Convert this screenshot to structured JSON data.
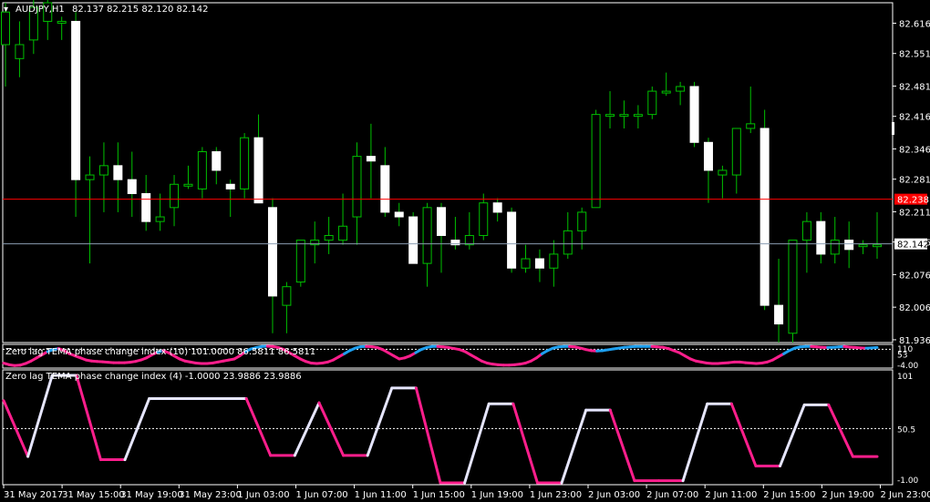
{
  "main_header": {
    "symbol": "AUDJPY,H1",
    "ohlc": "82.137 82.215 82.120 82.142"
  },
  "price_axis": {
    "ticks": [
      "82.616",
      "82.551",
      "82.481",
      "82.416",
      "82.346",
      "82.281",
      "82.211",
      "82.146",
      "82.076",
      "82.006",
      "81.936"
    ],
    "red_line_price": "82.238",
    "bid_price": "82.142"
  },
  "indicator1": {
    "title": "Zero lag TEMA phase change index (10) 101.0000 86.5811 86.5811",
    "axis_labels": [
      "110",
      "53",
      "-4.00"
    ]
  },
  "indicator2": {
    "title": "Zero lag TEMA phase change index (4) -1.0000 23.9886 23.9886",
    "axis_labels": [
      "101",
      "50.5",
      "-1.00"
    ]
  },
  "time_axis": {
    "labels": [
      "31 May 2017",
      "31 May 15:00",
      "31 May 19:00",
      "31 May 23:00",
      "1 Jun 03:00",
      "1 Jun 07:00",
      "1 Jun 11:00",
      "1 Jun 15:00",
      "1 Jun 19:00",
      "1 Jun 23:00",
      "2 Jun 03:00",
      "2 Jun 07:00",
      "2 Jun 11:00",
      "2 Jun 15:00",
      "2 Jun 19:00",
      "2 Jun 23:00"
    ]
  },
  "colors": {
    "background": "#000000",
    "grid": "#ffffff",
    "bull_candle": "#ffffff",
    "wick": "#00c000",
    "red_line": "#ff0000",
    "bid_line": "#8a9bb0",
    "ind_pink": "#ff1e8c",
    "ind_cyan": "#1ea0f0",
    "ind_white": "#e6e6ff"
  },
  "chart_data": [
    {
      "type": "candlestick",
      "title": "AUDJPY,H1",
      "ylim": [
        81.93,
        82.66
      ],
      "candles": [
        {
          "o": 82.57,
          "h": 82.66,
          "l": 82.48,
          "c": 82.64
        },
        {
          "o": 82.54,
          "h": 82.62,
          "l": 82.5,
          "c": 82.57
        },
        {
          "o": 82.58,
          "h": 82.67,
          "l": 82.55,
          "c": 82.65
        },
        {
          "o": 82.62,
          "h": 82.68,
          "l": 82.58,
          "c": 82.66
        },
        {
          "o": 82.62,
          "h": 82.63,
          "l": 82.58,
          "c": 82.62
        },
        {
          "o": 82.62,
          "h": 82.64,
          "l": 82.2,
          "c": 82.28
        },
        {
          "o": 82.28,
          "h": 82.33,
          "l": 82.1,
          "c": 82.29
        },
        {
          "o": 82.29,
          "h": 82.36,
          "l": 82.21,
          "c": 82.31
        },
        {
          "o": 82.31,
          "h": 82.36,
          "l": 82.21,
          "c": 82.28
        },
        {
          "o": 82.28,
          "h": 82.34,
          "l": 82.2,
          "c": 82.25
        },
        {
          "o": 82.25,
          "h": 82.29,
          "l": 82.17,
          "c": 82.19
        },
        {
          "o": 82.19,
          "h": 82.25,
          "l": 82.17,
          "c": 82.2
        },
        {
          "o": 82.22,
          "h": 82.29,
          "l": 82.18,
          "c": 82.27
        },
        {
          "o": 82.27,
          "h": 82.31,
          "l": 82.26,
          "c": 82.27
        },
        {
          "o": 82.26,
          "h": 82.35,
          "l": 82.24,
          "c": 82.34
        },
        {
          "o": 82.34,
          "h": 82.35,
          "l": 82.27,
          "c": 82.3
        },
        {
          "o": 82.27,
          "h": 82.28,
          "l": 82.2,
          "c": 82.26
        },
        {
          "o": 82.26,
          "h": 82.38,
          "l": 82.24,
          "c": 82.37
        },
        {
          "o": 82.37,
          "h": 82.42,
          "l": 82.23,
          "c": 82.23
        },
        {
          "o": 82.22,
          "h": 82.24,
          "l": 81.95,
          "c": 82.03
        },
        {
          "o": 82.01,
          "h": 82.06,
          "l": 81.95,
          "c": 82.05
        },
        {
          "o": 82.06,
          "h": 82.15,
          "l": 82.05,
          "c": 82.15
        },
        {
          "o": 82.14,
          "h": 82.19,
          "l": 82.1,
          "c": 82.15
        },
        {
          "o": 82.15,
          "h": 82.2,
          "l": 82.12,
          "c": 82.16
        },
        {
          "o": 82.15,
          "h": 82.25,
          "l": 82.14,
          "c": 82.18
        },
        {
          "o": 82.2,
          "h": 82.36,
          "l": 82.14,
          "c": 82.33
        },
        {
          "o": 82.33,
          "h": 82.4,
          "l": 82.24,
          "c": 82.32
        },
        {
          "o": 82.31,
          "h": 82.35,
          "l": 82.2,
          "c": 82.21
        },
        {
          "o": 82.21,
          "h": 82.23,
          "l": 82.18,
          "c": 82.2
        },
        {
          "o": 82.2,
          "h": 82.21,
          "l": 82.1,
          "c": 82.1
        },
        {
          "o": 82.1,
          "h": 82.23,
          "l": 82.05,
          "c": 82.22
        },
        {
          "o": 82.22,
          "h": 82.23,
          "l": 82.08,
          "c": 82.16
        },
        {
          "o": 82.15,
          "h": 82.2,
          "l": 82.13,
          "c": 82.14
        },
        {
          "o": 82.14,
          "h": 82.21,
          "l": 82.13,
          "c": 82.16
        },
        {
          "o": 82.16,
          "h": 82.25,
          "l": 82.15,
          "c": 82.23
        },
        {
          "o": 82.23,
          "h": 82.24,
          "l": 82.19,
          "c": 82.21
        },
        {
          "o": 82.21,
          "h": 82.22,
          "l": 82.08,
          "c": 82.09
        },
        {
          "o": 82.09,
          "h": 82.14,
          "l": 82.08,
          "c": 82.11
        },
        {
          "o": 82.11,
          "h": 82.13,
          "l": 82.06,
          "c": 82.09
        },
        {
          "o": 82.09,
          "h": 82.15,
          "l": 82.05,
          "c": 82.12
        },
        {
          "o": 82.12,
          "h": 82.21,
          "l": 82.11,
          "c": 82.17
        },
        {
          "o": 82.17,
          "h": 82.22,
          "l": 82.13,
          "c": 82.21
        },
        {
          "o": 82.22,
          "h": 82.43,
          "l": 82.22,
          "c": 82.42
        },
        {
          "o": 82.42,
          "h": 82.47,
          "l": 82.39,
          "c": 82.42
        },
        {
          "o": 82.42,
          "h": 82.45,
          "l": 82.39,
          "c": 82.42
        },
        {
          "o": 82.42,
          "h": 82.44,
          "l": 82.39,
          "c": 82.42
        },
        {
          "o": 82.42,
          "h": 82.48,
          "l": 82.41,
          "c": 82.47
        },
        {
          "o": 82.47,
          "h": 82.51,
          "l": 82.46,
          "c": 82.47
        },
        {
          "o": 82.47,
          "h": 82.49,
          "l": 82.44,
          "c": 82.48
        },
        {
          "o": 82.48,
          "h": 82.49,
          "l": 82.35,
          "c": 82.36
        },
        {
          "o": 82.36,
          "h": 82.37,
          "l": 82.23,
          "c": 82.3
        },
        {
          "o": 82.29,
          "h": 82.31,
          "l": 82.24,
          "c": 82.3
        },
        {
          "o": 82.29,
          "h": 82.39,
          "l": 82.25,
          "c": 82.39
        },
        {
          "o": 82.39,
          "h": 82.48,
          "l": 82.38,
          "c": 82.4
        },
        {
          "o": 82.39,
          "h": 82.43,
          "l": 82.0,
          "c": 82.01
        },
        {
          "o": 82.01,
          "h": 82.11,
          "l": 81.93,
          "c": 81.97
        },
        {
          "o": 81.95,
          "h": 82.12,
          "l": 81.93,
          "c": 82.15
        },
        {
          "o": 82.15,
          "h": 82.21,
          "l": 82.08,
          "c": 82.19
        },
        {
          "o": 82.19,
          "h": 82.21,
          "l": 82.1,
          "c": 82.12
        },
        {
          "o": 82.12,
          "h": 82.2,
          "l": 82.1,
          "c": 82.15
        },
        {
          "o": 82.15,
          "h": 82.19,
          "l": 82.09,
          "c": 82.13
        },
        {
          "o": 82.14,
          "h": 82.15,
          "l": 82.12,
          "c": 82.14
        },
        {
          "o": 82.14,
          "h": 82.21,
          "l": 82.11,
          "c": 82.14
        }
      ]
    },
    {
      "type": "line",
      "title": "Zero lag TEMA phase change index (10)",
      "ylim": [
        -4,
        110
      ],
      "values": [
        20,
        12,
        8,
        10,
        18,
        30,
        45,
        60,
        75,
        85,
        90,
        80,
        65,
        55,
        45,
        35,
        30,
        28,
        26,
        24,
        22,
        22,
        22,
        24,
        28,
        35,
        45,
        60,
        72,
        80,
        70,
        55,
        40,
        30,
        25,
        20,
        18,
        18,
        20,
        25,
        30,
        35,
        40,
        55,
        75,
        88,
        95,
        100,
        101,
        100,
        95,
        85,
        70,
        55,
        40,
        28,
        20,
        18,
        20,
        25,
        35,
        50,
        65,
        80,
        92,
        99,
        100,
        99,
        95,
        85,
        70,
        55,
        40,
        45,
        55,
        70,
        85,
        95,
        100,
        100,
        98,
        95,
        90,
        85,
        75,
        60,
        45,
        30,
        20,
        15,
        12,
        10,
        10,
        12,
        15,
        20,
        30,
        45,
        65,
        80,
        92,
        98,
        100,
        100,
        98,
        92,
        85,
        80,
        78,
        80,
        84,
        88,
        92,
        96,
        98,
        100,
        100,
        100,
        100,
        98,
        96,
        90,
        80,
        70,
        55,
        40,
        30,
        25,
        20,
        18,
        18,
        20,
        22,
        25,
        25,
        22,
        20,
        18,
        20,
        25,
        35,
        50,
        65,
        80,
        92,
        98,
        100,
        100,
        98,
        96,
        95,
        96,
        98,
        100,
        97,
        95,
        93,
        92,
        93,
        95
      ]
    },
    {
      "type": "line",
      "title": "Zero lag TEMA phase change index (4)",
      "ylim": [
        -1,
        101
      ],
      "values": [
        77,
        24,
        101,
        101,
        21,
        21,
        79,
        79,
        79,
        79,
        79,
        25,
        25,
        75,
        25,
        25,
        89,
        89,
        -1,
        -1,
        74,
        74,
        -1,
        -1,
        68,
        68,
        1,
        1,
        1,
        74,
        74,
        15,
        15,
        73,
        73,
        24,
        24
      ]
    }
  ]
}
